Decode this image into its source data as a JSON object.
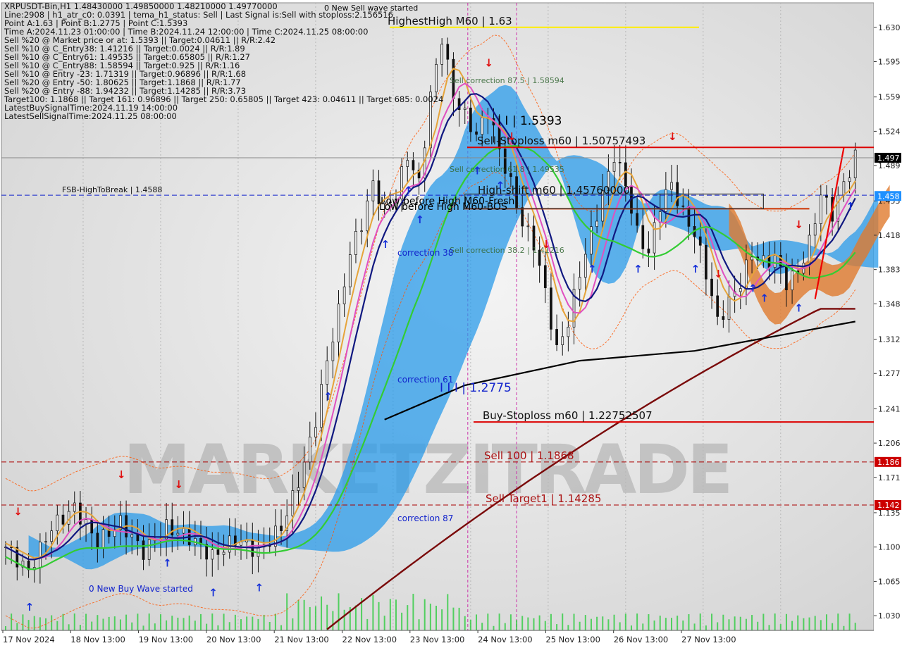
{
  "info_lines": [
    "XRPUSDT-Bin,H1   1.48430000 1.49850000 1.48210000 1.49770000",
    "Line:2908 | h1_atr_c0: 0.0391 | tema_h1_status: Sell | Last Signal is:Sell with stoploss:2.156516",
    "Point A:1.63 | Point B:1.2775 | Point C:1.5393",
    "Time A:2024.11.23 01:00:00 | Time B:2024.11.24 12:00:00 | Time C:2024.11.25 08:00:00",
    "Sell %20 @ Market price or at: 1.5393 || Target:0.04611 || R/R:2.42",
    "Sell %10 @ C_Entry38: 1.41216 || Target:0.0024 || R/R:1.89",
    "Sell %10 @ C_Entry61: 1.49535 || Target:0.65805 || R/R:1.27",
    "Sell %10 @ C_Entry88: 1.58594 || Target:0.925 || R/R:1.16",
    "Sell %10 @ Entry -23: 1.71319 || Target:0.96896 || R/R:1.68",
    "Sell %20 @ Entry -50: 1.80625 || Target:1.1868 || R/R:1.77",
    "Sell %20 @ Entry -88: 1.94232 || Target:1.14285 || R/R:3.73",
    "Target100: 1.1868 || Target 161: 0.96896 || Target 250: 0.65805 || Target 423: 0.04611 || Target 685: 0.0024",
    "LatestBuySignalTime:2024.11.19 14:00:00",
    "LatestSellSignalTime:2024.11.25 08:00:00"
  ],
  "watermark": "MARKETZITRADE",
  "chart_data": {
    "type": "candlestick",
    "symbol": "XRPUSDT-Bin",
    "timeframe": "H1",
    "ohlc_last": {
      "open": 1.4843,
      "high": 1.4985,
      "low": 1.4821,
      "close": 1.4977
    },
    "ylim": [
      1.015,
      1.655
    ],
    "y_ticks": [
      "1.630",
      "1.595",
      "1.559",
      "1.524",
      "1.489",
      "1.453",
      "1.418",
      "1.383",
      "1.348",
      "1.312",
      "1.277",
      "1.241",
      "1.206",
      "1.171",
      "1.135",
      "1.100",
      "1.065",
      "1.030"
    ],
    "x_labels": [
      "17 Nov 2024",
      "18 Nov 13:00",
      "19 Nov 13:00",
      "20 Nov 13:00",
      "21 Nov 13:00",
      "22 Nov 13:00",
      "23 Nov 13:00",
      "24 Nov 13:00",
      "25 Nov 13:00",
      "26 Nov 13:00",
      "27 Nov 13:00"
    ],
    "close_path": [
      [
        0,
        1.1
      ],
      [
        4,
        1.075
      ],
      [
        8,
        1.12
      ],
      [
        12,
        1.14
      ],
      [
        16,
        1.105
      ],
      [
        20,
        1.125
      ],
      [
        24,
        1.095
      ],
      [
        28,
        1.12
      ],
      [
        32,
        1.11
      ],
      [
        36,
        1.09
      ],
      [
        40,
        1.108
      ],
      [
        44,
        1.095
      ],
      [
        48,
        1.12
      ],
      [
        50,
        1.15
      ],
      [
        52,
        1.185
      ],
      [
        54,
        1.23
      ],
      [
        56,
        1.29
      ],
      [
        58,
        1.34
      ],
      [
        60,
        1.4
      ],
      [
        62,
        1.43
      ],
      [
        64,
        1.47
      ],
      [
        66,
        1.445
      ],
      [
        68,
        1.46
      ],
      [
        70,
        1.5
      ],
      [
        72,
        1.47
      ],
      [
        74,
        1.56
      ],
      [
        76,
        1.62
      ],
      [
        78,
        1.56
      ],
      [
        80,
        1.54
      ],
      [
        82,
        1.52
      ],
      [
        84,
        1.545
      ],
      [
        86,
        1.505
      ],
      [
        88,
        1.47
      ],
      [
        90,
        1.43
      ],
      [
        92,
        1.41
      ],
      [
        94,
        1.36
      ],
      [
        96,
        1.3
      ],
      [
        98,
        1.33
      ],
      [
        100,
        1.38
      ],
      [
        102,
        1.42
      ],
      [
        104,
        1.46
      ],
      [
        106,
        1.5
      ],
      [
        108,
        1.47
      ],
      [
        110,
        1.42
      ],
      [
        112,
        1.4
      ],
      [
        114,
        1.45
      ],
      [
        116,
        1.47
      ],
      [
        118,
        1.44
      ],
      [
        120,
        1.42
      ],
      [
        122,
        1.38
      ],
      [
        124,
        1.33
      ],
      [
        126,
        1.35
      ],
      [
        128,
        1.37
      ],
      [
        130,
        1.4
      ],
      [
        132,
        1.39
      ],
      [
        134,
        1.395
      ],
      [
        136,
        1.37
      ],
      [
        138,
        1.38
      ],
      [
        140,
        1.41
      ],
      [
        142,
        1.46
      ],
      [
        144,
        1.44
      ],
      [
        146,
        1.47
      ],
      [
        148,
        1.4977
      ]
    ],
    "series": [
      {
        "name": "",
        "color": "#000000",
        "points": [
          [
            66,
            1.23
          ],
          [
            80,
            1.265
          ],
          [
            100,
            1.29
          ],
          [
            120,
            1.3
          ],
          [
            148,
            1.33
          ]
        ]
      }
    ],
    "levels": [
      {
        "label": "HighestHigh   M60 | 1.63",
        "value": 1.63,
        "color": "#ffee00",
        "style": "solid"
      },
      {
        "label": "Sell-Stoploss m60 | 1.50757493",
        "value": 1.5076,
        "color": "#dd0000",
        "style": "solid"
      },
      {
        "label": "FSB-HighToBreak | 1.4588",
        "value": 1.4588,
        "color": "#1122cc",
        "style": "dashed"
      },
      {
        "label": "High-shift m60 | 1.45760000",
        "value": 1.4576,
        "color": "#000000",
        "style": "none"
      },
      {
        "label": "Buy-Stoploss m60 | 1.22752507",
        "value": 1.2275,
        "color": "#dd0000",
        "style": "solid"
      },
      {
        "label": "Sell 100 | 1.1868",
        "value": 1.1868,
        "color": "#aa0000",
        "style": "dashed"
      },
      {
        "label": "Sell Target1 | 1.14285",
        "value": 1.14285,
        "color": "#aa0000",
        "style": "dashed"
      }
    ],
    "annotations": [
      {
        "text": "0 New Sell wave started",
        "color": "#000000"
      },
      {
        "text": "Sell correction 87.5 | 1.58594",
        "color": "#336633"
      },
      {
        "text": "I I | 1.5393",
        "color": "#000000"
      },
      {
        "text": "Sell correction 61.8 | 1.49535",
        "color": "#336633"
      },
      {
        "text": "Low before High   M60-Fresh",
        "color": "#000000"
      },
      {
        "text": "Low before High   M60-BOS",
        "color": "#000000"
      },
      {
        "text": "Sell correction 38.2 | 1.41216",
        "color": "#336633"
      },
      {
        "text": "correction 38",
        "color": "#1122cc"
      },
      {
        "text": "correction 61",
        "color": "#1122cc"
      },
      {
        "text": "I I I | 1.2775",
        "color": "#1122cc"
      },
      {
        "text": "correction 87",
        "color": "#1122cc"
      },
      {
        "text": "0 New Buy Wave started",
        "color": "#1122cc"
      }
    ],
    "price_tags": [
      {
        "text": "1.497",
        "value": 1.497,
        "bg": "#000000",
        "fg": "#ffffff"
      },
      {
        "text": "1.458",
        "value": 1.458,
        "bg": "#1e90ff",
        "fg": "#ffffff"
      },
      {
        "text": "1.186",
        "value": 1.1868,
        "bg": "#cc0000",
        "fg": "#ffffff"
      },
      {
        "text": "1.142",
        "value": 1.14285,
        "bg": "#cc0000",
        "fg": "#ffffff"
      }
    ]
  }
}
